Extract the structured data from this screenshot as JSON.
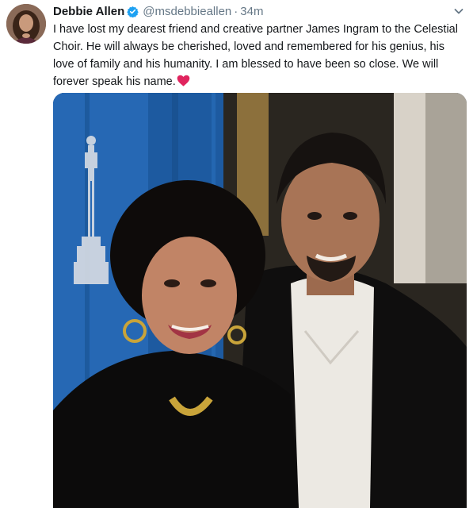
{
  "tweet": {
    "author_name": "Debbie Allen",
    "handle": "@msdebbieallen",
    "separator": "·",
    "time": "34m",
    "text": "I have lost my dearest friend and creative partner James Ingram to the Celestial Choir. He will always be cherished, loved and remembered for his genius, his love of family and his humanity. I am blessed to have been so close. We will forever speak his name.",
    "emoji": "red-heart",
    "icons": {
      "verified": "verified-badge-icon",
      "menu": "chevron-down-icon"
    },
    "colors": {
      "text": "#14171a",
      "secondary": "#657786",
      "verified": "#1da1f2",
      "heart": "#e0245e"
    }
  }
}
